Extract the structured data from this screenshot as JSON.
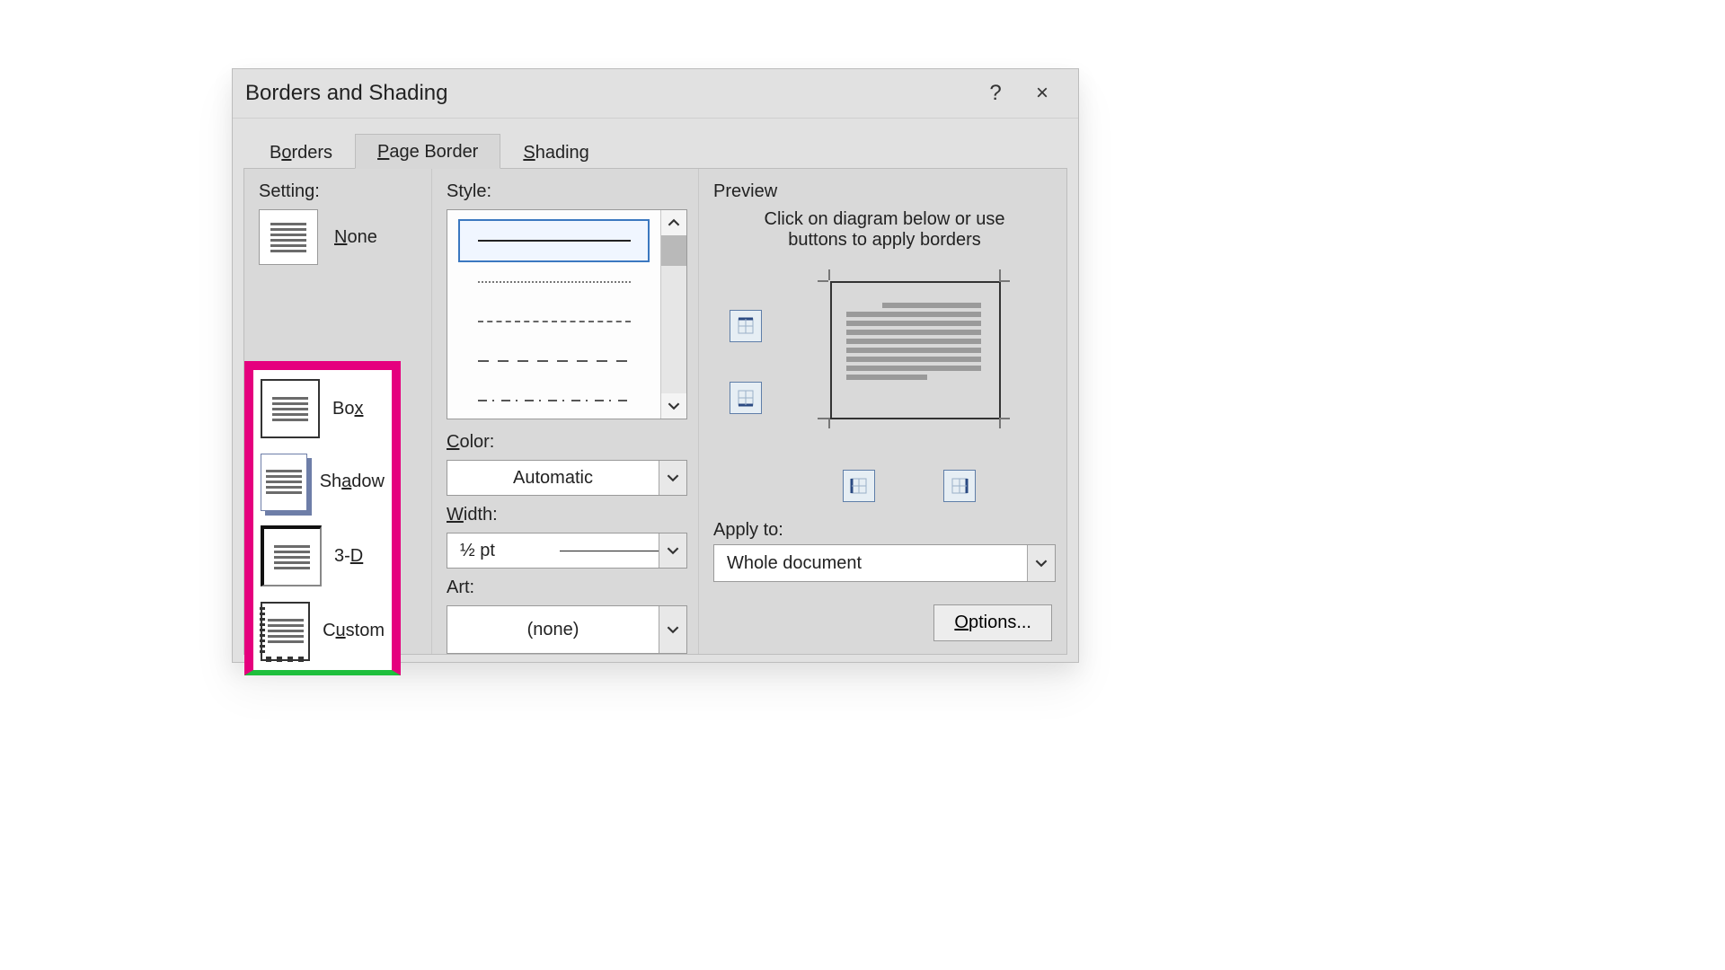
{
  "dialog": {
    "title": "Borders and Shading",
    "help_icon": "?",
    "close_icon": "×"
  },
  "tabs": {
    "borders_pre": "B",
    "borders_u": "o",
    "borders_post": "rders",
    "page_border_u": "P",
    "page_border_rest": "age Border",
    "shading_u": "S",
    "shading_rest": "hading"
  },
  "setting": {
    "label": "Setting:",
    "none_u": "N",
    "none_rest": "one",
    "box_pre": "Bo",
    "box_u": "x",
    "shadow_pre": "Sh",
    "shadow_u": "a",
    "shadow_post": "dow",
    "threeD_pre": "3-",
    "threeD_u": "D",
    "custom_pre": "C",
    "custom_u": "u",
    "custom_post": "stom"
  },
  "style": {
    "label": "Style:"
  },
  "color": {
    "label_u": "C",
    "label_rest": "olor:",
    "value": "Automatic"
  },
  "width": {
    "label_u": "W",
    "label_rest": "idth:",
    "value": "½ pt"
  },
  "art": {
    "label": "Art:",
    "value": "(none)"
  },
  "preview": {
    "label": "Preview",
    "hint": "Click on diagram below or use buttons to apply borders"
  },
  "applyto": {
    "label": "Apply to:",
    "value": "Whole document"
  },
  "buttons": {
    "options_u": "O",
    "options_rest": "ptions..."
  }
}
